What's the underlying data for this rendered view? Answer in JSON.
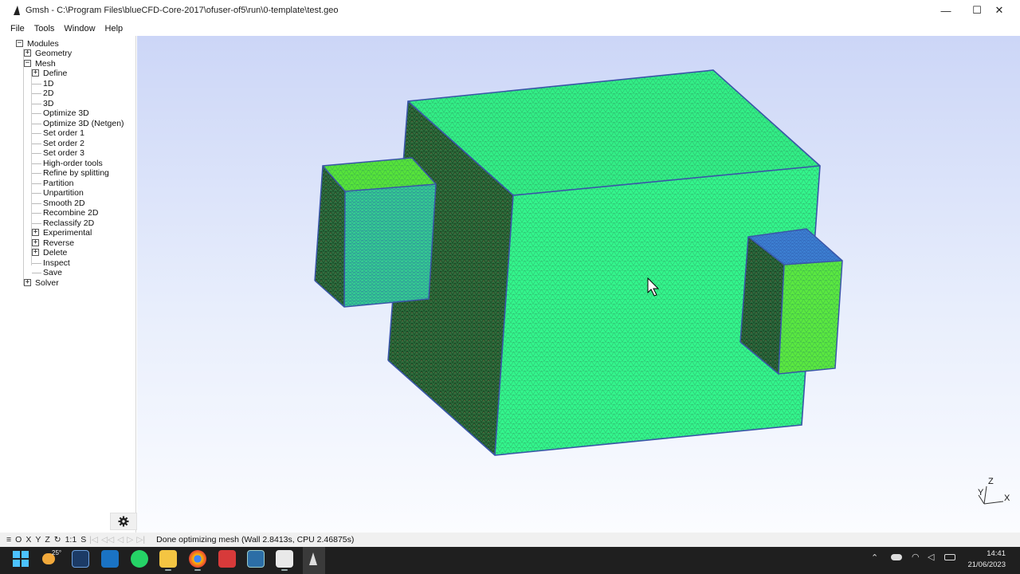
{
  "window": {
    "title": "Gmsh - C:\\Program Files\\blueCFD-Core-2017\\ofuser-of5\\run\\0-template\\test.geo",
    "minimize_glyph": "—",
    "maximize_glyph": "☐",
    "close_glyph": "✕"
  },
  "menu": {
    "items": [
      "File",
      "Tools",
      "Window",
      "Help"
    ]
  },
  "tree": {
    "modules": "Modules",
    "geometry": "Geometry",
    "mesh": "Mesh",
    "define": "Define",
    "mesh_items": [
      "1D",
      "2D",
      "3D",
      "Optimize 3D",
      "Optimize 3D (Netgen)",
      "Set order 1",
      "Set order 2",
      "Set order 3",
      "High-order tools",
      "Refine by splitting",
      "Partition",
      "Unpartition",
      "Smooth 2D",
      "Recombine 2D",
      "Reclassify 2D"
    ],
    "experimental": "Experimental",
    "reverse": "Reverse",
    "delete": "Delete",
    "inspect": "Inspect",
    "save": "Save",
    "solver": "Solver",
    "expand_glyph": "+",
    "collapse_glyph": "−"
  },
  "axes": {
    "z": "Z",
    "y": "Y",
    "x": "X"
  },
  "statusbar": {
    "buttons": [
      "≡",
      "O",
      "X",
      "Y",
      "Z",
      "↻",
      "1:1",
      "S"
    ],
    "nav": [
      "|◁",
      "◁◁",
      "◁",
      "▷",
      "▷|"
    ],
    "message": "Done optimizing mesh (Wall 2.8413s, CPU 2.46875s)"
  },
  "taskbar": {
    "weather": "25°",
    "time": "14:41",
    "date": "21/06/2023"
  },
  "colors": {
    "face_bright": "#33f58c",
    "face_dark": "#2a6f3f",
    "edge": "#3a56a8"
  }
}
